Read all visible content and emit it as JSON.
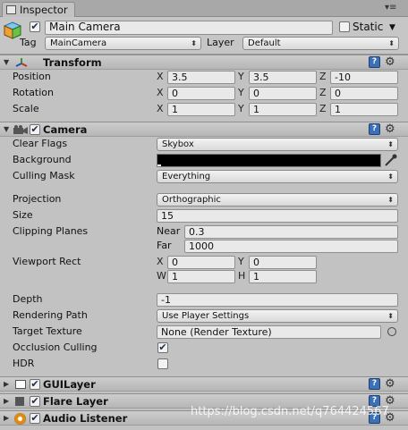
{
  "tab": {
    "label": "Inspector",
    "menu_icon": "panel-menu-icon"
  },
  "gameobject": {
    "active": true,
    "name": "Main Camera",
    "static_label": "Static",
    "tag_label": "Tag",
    "tag_value": "MainCamera",
    "layer_label": "Layer",
    "layer_value": "Default"
  },
  "transform": {
    "title": "Transform",
    "position_label": "Position",
    "rotation_label": "Rotation",
    "scale_label": "Scale",
    "axis_x": "X",
    "axis_y": "Y",
    "axis_z": "Z",
    "position": [
      "3.5",
      "3.5",
      "-10"
    ],
    "rotation": [
      "0",
      "0",
      "0"
    ],
    "scale": [
      "1",
      "1",
      "1"
    ]
  },
  "camera": {
    "title": "Camera",
    "enabled": true,
    "clear_flags_label": "Clear Flags",
    "clear_flags_value": "Skybox",
    "background_label": "Background",
    "background_color": "#000000",
    "culling_mask_label": "Culling Mask",
    "culling_mask_value": "Everything",
    "projection_label": "Projection",
    "projection_value": "Orthographic",
    "size_label": "Size",
    "size_value": "15",
    "clipping_label": "Clipping Planes",
    "near_label": "Near",
    "near_value": "0.3",
    "far_label": "Far",
    "far_value": "1000",
    "viewport_label": "Viewport Rect",
    "vp_x_label": "X",
    "vp_y_label": "Y",
    "vp_w_label": "W",
    "vp_h_label": "H",
    "vp_x": "0",
    "vp_y": "0",
    "vp_w": "1",
    "vp_h": "1",
    "depth_label": "Depth",
    "depth_value": "-1",
    "rendering_path_label": "Rendering Path",
    "rendering_path_value": "Use Player Settings",
    "target_texture_label": "Target Texture",
    "target_texture_value": "None (Render Texture)",
    "occlusion_label": "Occlusion Culling",
    "occlusion_checked": true,
    "hdr_label": "HDR",
    "hdr_checked": false
  },
  "components": [
    {
      "title": "GUILayer",
      "enabled": true
    },
    {
      "title": "Flare Layer",
      "enabled": true
    },
    {
      "title": "Audio Listener",
      "enabled": true
    }
  ],
  "watermark": "https://blog.csdn.net/q764424567",
  "colors": {
    "panel_bg": "#c2c2c2",
    "header_bg": "#b6b6b6",
    "help_blue": "#3b6fb6"
  }
}
